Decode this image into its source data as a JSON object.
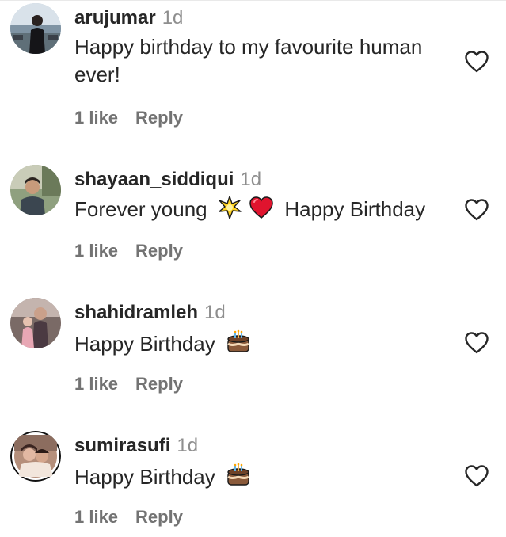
{
  "comments": [
    {
      "username": "arujumar",
      "time": "1d",
      "text": "Happy birthday to my favourite human ever!",
      "likes": "1 like",
      "reply": "Reply"
    },
    {
      "username": "shayaan_siddiqui",
      "time": "1d",
      "text_before": "Forever young",
      "text_after": "Happy Birthday",
      "emojis": [
        "sparkle-star-icon",
        "red-heart-icon"
      ],
      "likes": "1 like",
      "reply": "Reply"
    },
    {
      "username": "shahidramleh",
      "time": "1d",
      "text": "Happy Birthday",
      "emoji": "birthday-cake-icon",
      "likes": "1 like",
      "reply": "Reply"
    },
    {
      "username": "sumirasufi",
      "time": "1d",
      "text": "Happy Birthday",
      "emoji": "birthday-cake-icon",
      "likes": "1 like",
      "reply": "Reply"
    }
  ],
  "colors": {
    "text": "#262626",
    "muted": "#737373",
    "time": "#8e8e8e",
    "heart_stroke": "#262626"
  }
}
